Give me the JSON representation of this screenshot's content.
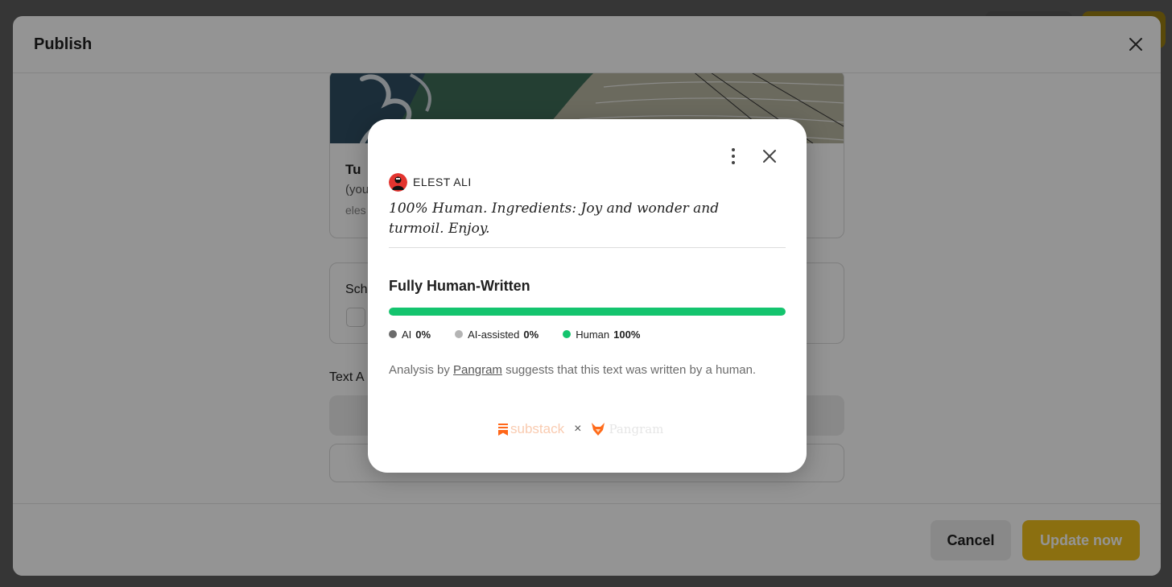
{
  "publish_modal": {
    "title": "Publish",
    "post_card": {
      "title": "Tu",
      "subtitle": "(you",
      "meta": "eles"
    },
    "schedule": {
      "label": "Sch"
    },
    "text_section": {
      "label": "Text A"
    },
    "footer": {
      "cancel_label": "Cancel",
      "update_label": "Update now"
    }
  },
  "result_dialog": {
    "author": "ELEST ALI",
    "quote": "100% Human. Ingredients: Joy and wonder and turmoil. Enjoy.",
    "verdict": "Fully Human-Written",
    "human_fraction": 1.0,
    "legend": [
      {
        "label": "AI",
        "value": "0%",
        "color": "#6b6b6b"
      },
      {
        "label": "AI-assisted",
        "value": "0%",
        "color": "#b4b4b4"
      },
      {
        "label": "Human",
        "value": "100%",
        "color": "#14c46e"
      }
    ],
    "analysis": {
      "prefix": "Analysis by",
      "link": "Pangram",
      "suffix": "suggests that this text was written by a human."
    },
    "branding": {
      "substack": "substack",
      "separator": "×",
      "pangram": "Pangram"
    }
  },
  "colors": {
    "accent_yellow": "#f0c01c",
    "human_green": "#14c46e",
    "substack_orange": "#ff6719"
  }
}
